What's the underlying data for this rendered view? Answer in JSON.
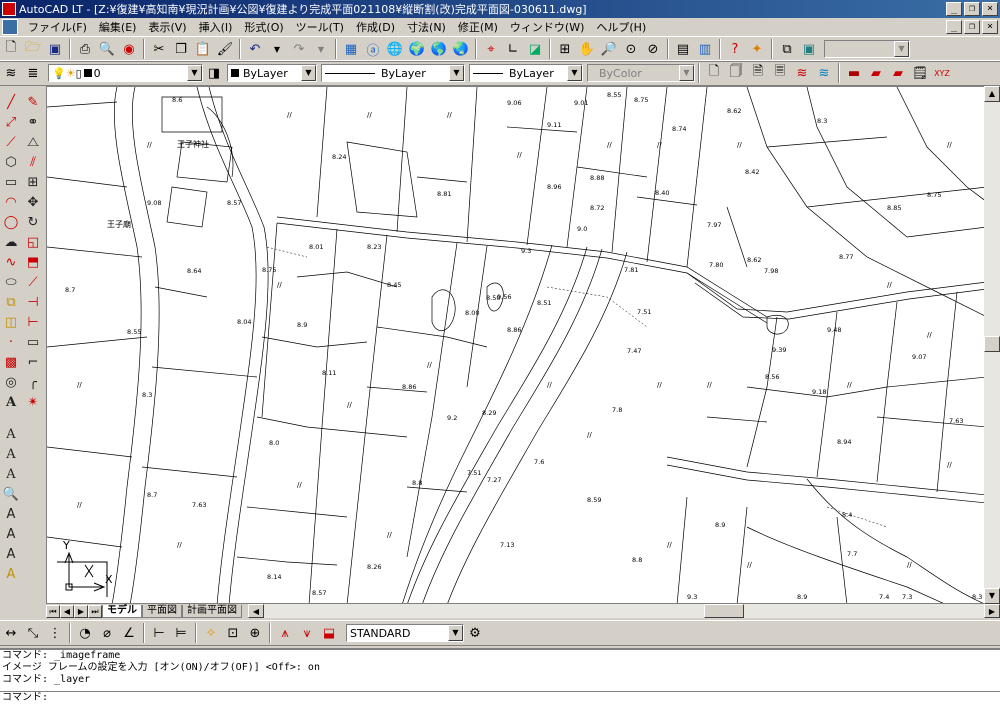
{
  "window": {
    "title": "AutoCAD LT - [Z:¥復建¥高知南¥現況計画¥公図¥復建より完成平面021108¥縦断割(改)完成平面図-030611.dwg]",
    "minimize": "_",
    "restore": "❐",
    "close": "×"
  },
  "menu": [
    "ファイル(F)",
    "編集(E)",
    "表示(V)",
    "挿入(I)",
    "形式(O)",
    "ツール(T)",
    "作成(D)",
    "寸法(N)",
    "修正(M)",
    "ウィンドウ(W)",
    "ヘルプ(H)"
  ],
  "properties": {
    "color_value": "ByLayer",
    "linetype_value": "ByLayer",
    "lineweight_value": "ByLayer",
    "plotstyle_value": "ByColor"
  },
  "dimension": {
    "style_value": "STANDARD"
  },
  "layout_tabs": [
    "モデル",
    "平面図",
    "計画平面図"
  ],
  "command_history": [
    "コマンド:  _imageframe",
    "イメージ フレームの設定を入力 [オン(ON)/オフ(OF)] <Off>: on",
    "コマンド:  _layer",
    "コマンド:"
  ],
  "map_labels": [
    "王子廟",
    "王子神社",
    "8.6",
    "8.24",
    "8.57",
    "9.08",
    "8.64",
    "8.7",
    "8.55",
    "8.3",
    "8.7",
    "7.63",
    "8.14",
    "8.57",
    "8.04",
    "8.9",
    "8.75",
    "8.01",
    "8.23",
    "8.45",
    "8.11",
    "8.86",
    "8.0",
    "8.26",
    "9.2",
    "8.29",
    "8.8",
    "7.51",
    "7.27",
    "7.13",
    "7.6",
    "8.00",
    "8.50",
    "8.86",
    "9.56",
    "8.51",
    "9.3",
    "9.06",
    "9.01",
    "9.11",
    "8.81",
    "8.96",
    "8.88",
    "8.72",
    "8.55",
    "8.75",
    "8.74",
    "8.40",
    "9.0",
    "7.81",
    "7.51",
    "7.47",
    "7.8",
    "8.59",
    "8.9",
    "8.8",
    "8.62",
    "8.3",
    "8.42",
    "7.97",
    "7.80",
    "7.98",
    "8.77",
    "8.85",
    "8.75",
    "9.48",
    "9.39",
    "8.56",
    "9.18",
    "9.07",
    "8.94",
    "7.63",
    "8.4",
    "7.7",
    "7.4",
    "8.3",
    "7.3",
    "8.9",
    "9.3",
    "8.62"
  ]
}
